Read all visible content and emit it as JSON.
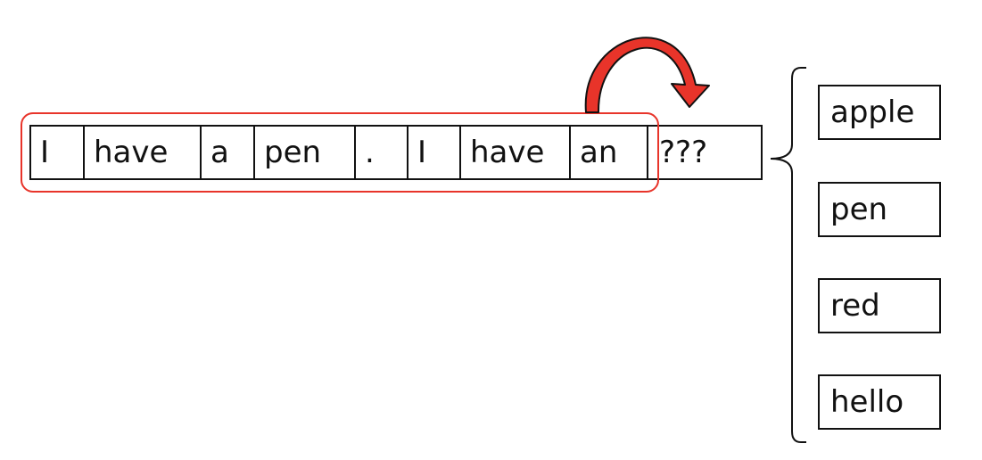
{
  "sentence_tokens": [
    "I",
    "have",
    "a",
    "pen",
    ".",
    "I",
    "have",
    "an",
    "???"
  ],
  "candidates": [
    "apple",
    "pen",
    "red",
    "hello"
  ],
  "colors": {
    "context_highlight": "#e8342a",
    "arrow_fill": "#e8342a",
    "arrow_outline": "#111111",
    "box_border": "#111111"
  }
}
